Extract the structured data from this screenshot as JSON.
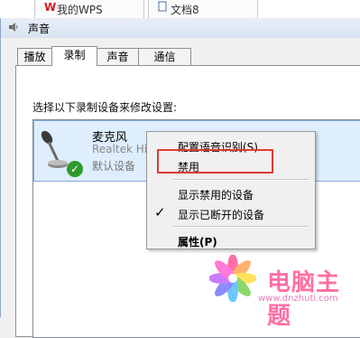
{
  "top_tabs": [
    {
      "label": "我的WPS"
    },
    {
      "label": "文档8"
    }
  ],
  "dialog": {
    "title": "声音",
    "tabs": [
      "播放",
      "录制",
      "声音",
      "通信"
    ],
    "active_tab": "录制",
    "instruction": "选择以下录制设备来修改设置:"
  },
  "device": {
    "name": "麦克风",
    "driver": "Realtek Hig",
    "status": "默认设备"
  },
  "context_menu": {
    "items": [
      {
        "label": "配置语音识别(S)"
      },
      {
        "label": "禁用"
      },
      {
        "label": "显示禁用的设备"
      },
      {
        "label": "显示已断开的设备",
        "checked": true
      },
      {
        "label": "属性(P)"
      }
    ]
  },
  "watermark": {
    "title": "电脑主题",
    "url": "www.dnzhuti.com"
  },
  "colors": {
    "highlight_border": "#e03a35",
    "selection": "#dfeefe",
    "watermark_pink": "#ff6fa4"
  }
}
